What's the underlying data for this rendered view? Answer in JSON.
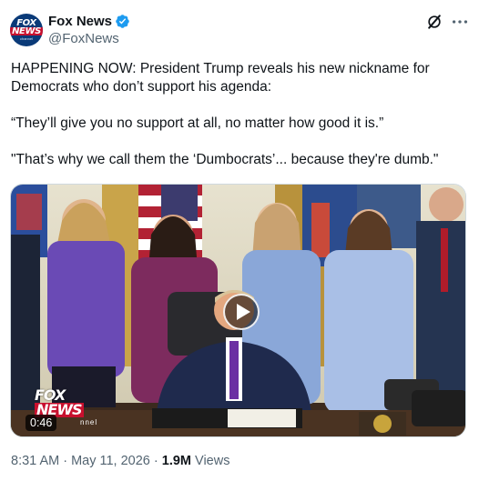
{
  "post": {
    "author_name": "Fox News",
    "author_handle": "@FoxNews",
    "avatar_text": {
      "line1": "FOX",
      "line2": "NEWS",
      "line3": "channel"
    },
    "paragraphs": [
      "HAPPENING NOW: President Trump reveals his new nickname for Democrats who don’t support his agenda:",
      "“They’ll give you no support at all, no matter how good it is.”",
      "\"That’s why we call them the ‘Dumbocrats’... because they're dumb.\""
    ],
    "media": {
      "type": "video",
      "duration": "0:46",
      "watermark": {
        "line1": "FOX",
        "line2": "NEWS",
        "line3": "nnel"
      }
    },
    "timestamp": "8:31 AM · May 11, 2026",
    "separator": " · ",
    "views_count": "1.9M",
    "views_label": "Views"
  },
  "icons": {
    "verified": "verified-badge-icon",
    "grok": "grok-icon",
    "more": "more-options-icon",
    "play": "play-icon"
  },
  "colors": {
    "verified_blue": "#1d9bf0",
    "secondary_text": "#536471",
    "primary_text": "#0f1419",
    "fox_navy": "#0a3a78",
    "fox_red": "#c8102e"
  }
}
